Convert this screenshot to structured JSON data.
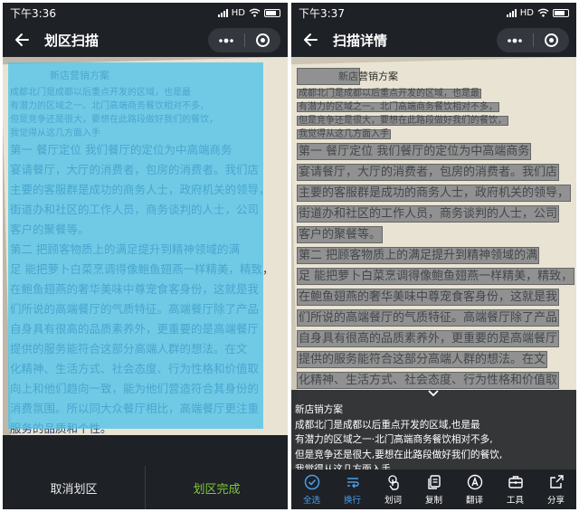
{
  "left_screen": {
    "status": {
      "time": "下午3:36",
      "network": "HD"
    },
    "nav": {
      "title": "划区扫描"
    },
    "document_lines": [
      "新店营销方案",
      "成都北门是成都以后重点开发的区域，也是最",
      "有潜力的区域之一。北门高端商务餐饮相对不多，",
      "但是竞争还是很大，要想在此路段做好我们的餐饮，",
      "我觉得从这几方面入手",
      "第一 餐厅定位 我们餐厅的定位为中高端商务",
      "宴请餐厅，大厅的消费者，包房的消费者。我们店",
      "主要的客服群是成功的商务人士，政府机关的领导，",
      "街道办和社区的工作人员，商务谈判的人士，公司",
      "客户的聚餐等。",
      "第二 把顾客物质上的满足提升到精神领域的满",
      "足 能把萝卜白菜烹调得像鲍鱼翅燕一样精美，精致，",
      "在鲍鱼翅燕的奢华美味中尊宠食客身份，这就是我",
      "们所说的高端餐厅的气质特征。高端餐厅除了产品",
      "自身具有很高的品质素养外，更重要的是高端餐厅",
      "提供的服务能符合这部分高端人群的想法。在文",
      "化精神、生活方式、社会态度、行为性格和价值取",
      "向上和他们趋向一致，能为他们营造符合其身份的",
      "消费氛围。所以同大众餐厅相比，高端餐厅更注重",
      "服务的品质和个性。"
    ],
    "actions": {
      "cancel": "取消划区",
      "done": "划区完成"
    }
  },
  "right_screen": {
    "status": {
      "time": "下午3:37",
      "network": "HD"
    },
    "nav": {
      "title": "扫描详情"
    },
    "document_lines": [
      "新店营销方案",
      "成都北门是成都以后重点开发的区域，也是最",
      "有潜力的区域之一。北门高端商务餐饮相对不多，",
      "但是竞争还是很大，要想在此路段做好我们的餐饮，",
      "我觉得从这几方面入手",
      "第一 餐厅定位 我们餐厅的定位为中高端商务",
      "宴请餐厅，大厅的消费者，包房的消费者。我们店",
      "主要的客服群是成功的商务人士，政府机关的领导，",
      "街道办和社区的工作人员，商务谈判的人士，公司",
      "客户的聚餐等。",
      "第二 把顾客物质上的满足提升到精神领域的满",
      "足 能把萝卜白菜烹调得像鲍鱼翅燕一样精美，精致，",
      "在鲍鱼翅燕的奢华美味中尊宠食客身份，这就是我",
      "们所说的高端餐厅的气质特征。高端餐厅除了产品",
      "自身具有很高的品质素养外，更重要的是高端餐厅",
      "提供的服务能符合这部分高端人群的想法。在文",
      "化精神、生活方式、社会态度、行为性格和价值取"
    ],
    "ocr_result": [
      "新店销方案",
      "成都北门是成都以后重点开发的区域,也是最",
      "有潜力的区域之一·北门高端商务餐饮相对不多,",
      "但是竞争还是很大,要想在此路段做好我们的餐饮,",
      "我觉得从这几方面入手"
    ],
    "toolbar": [
      {
        "label": "全选",
        "icon": "check-circle-icon"
      },
      {
        "label": "换行",
        "icon": "line-break-icon"
      },
      {
        "label": "划词",
        "icon": "tap-hand-icon"
      },
      {
        "label": "复制",
        "icon": "copy-icon"
      },
      {
        "label": "翻译",
        "icon": "translate-icon"
      },
      {
        "label": "工具",
        "icon": "toolbox-icon"
      },
      {
        "label": "分享",
        "icon": "share-icon"
      }
    ]
  },
  "colors": {
    "bar_bg": "#1e2126",
    "selection": "#50c3eb",
    "done_green": "#7fc83a",
    "active_blue": "#4a9ee8",
    "highlight_grey": "#555a64"
  }
}
